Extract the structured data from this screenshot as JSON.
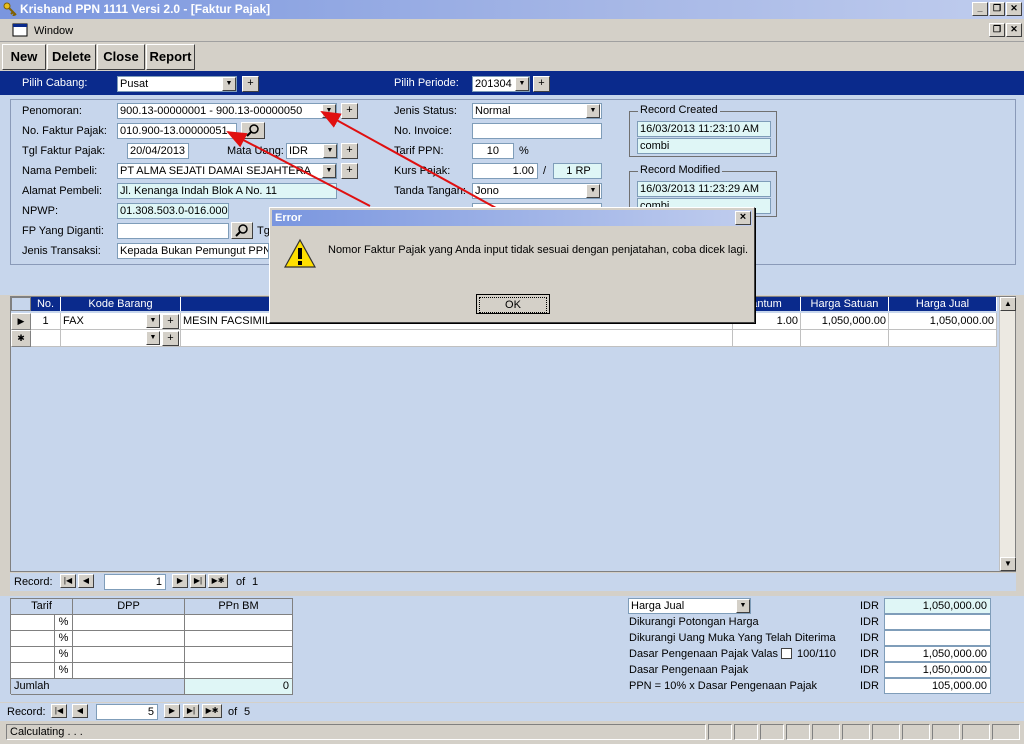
{
  "app": {
    "title": "Krishand PPN 1111 Versi 2.0 - [Faktur Pajak]",
    "menu_window": "Window"
  },
  "toolbar": {
    "new": "New",
    "delete": "Delete",
    "close": "Close",
    "report": "Report"
  },
  "header": {
    "cabang_label": "Pilih Cabang:",
    "cabang_value": "Pusat",
    "periode_label": "Pilih Periode:",
    "periode_value": "201304",
    "plus": "+"
  },
  "form": {
    "penomoran_label": "Penomoran:",
    "penomoran_value": "900.13-00000001 - 900.13-00000050",
    "nofaktur_label": "No. Faktur Pajak:",
    "nofaktur_value": "010.900-13.00000051",
    "tgl_label": "Tgl Faktur Pajak:",
    "tgl_value": "20/04/2013",
    "mata_label": "Mata Uang:",
    "mata_value": "IDR",
    "pembeli_label": "Nama Pembeli:",
    "pembeli_value": "PT ALMA SEJATI DAMAI SEJAHTERA",
    "alamat_label": "Alamat Pembeli:",
    "alamat_value": "Jl. Kenanga Indah Blok A No. 11",
    "npwp_label": "NPWP:",
    "npwp_value": "01.308.503.0-016.000",
    "fp_label": "FP Yang Diganti:",
    "fp_value": "",
    "tg_label": "Tg",
    "transaksi_label": "Jenis Transaksi:",
    "transaksi_value": "Kepada Bukan Pemungut PPN",
    "status_label": "Jenis Status:",
    "status_value": "Normal",
    "invoice_label": "No. Invoice:",
    "invoice_value": "",
    "tarif_label": "Tarif PPN:",
    "tarif_value": "10",
    "tarif_unit": "%",
    "kurs_label": "Kurs Pajak:",
    "kurs_value": "1.00",
    "kurs_sep": "/",
    "kurs_unit": "1 RP",
    "ttd_label": "Tanda Tangan:",
    "ttd_value": "Jono",
    "created_title": "Record Created",
    "created_date": "16/03/2013 11:23:10 AM",
    "created_user": "combi",
    "modified_title": "Record Modified",
    "modified_date": "16/03/2013 11:23:29 AM",
    "modified_user": "combi"
  },
  "grid": {
    "headers": {
      "no": "No.",
      "kode": "Kode Barang",
      "kuantum": "antum",
      "harga_satuan": "Harga Satuan",
      "harga_jual": "Harga Jual"
    },
    "row": {
      "no": "1",
      "kode": "FAX",
      "nama": "MESIN FACSIMILE",
      "kuantum": "1.00",
      "harga_satuan": "1,050,000.00",
      "harga_jual": "1,050,000.00"
    },
    "new_marker": "✱",
    "nav": {
      "label": "Record:",
      "value": "1",
      "of": "of",
      "total": "1"
    }
  },
  "tax": {
    "tarif": "Tarif",
    "dpp": "DPP",
    "ppnbm": "PPn BM",
    "pct": "%",
    "jumlah": "Jumlah",
    "jumlah_value": "0"
  },
  "summary": {
    "basis": "Harga Jual",
    "currency": "IDR",
    "harga_jual_value": "1,050,000.00",
    "potongan": "Dikurangi Potongan Harga",
    "uang_muka": "Dikurangi Uang Muka Yang Telah Diterima",
    "dpp_valas": "Dasar Pengenaan Pajak Valas",
    "ratio": "100/110",
    "dpp_valas_value": "1,050,000.00",
    "dpp": "Dasar Pengenaan Pajak",
    "dpp_value": "1,050,000.00",
    "ppn": "PPN = 10% x  Dasar Pengenaan Pajak",
    "ppn_value": "105,000.00"
  },
  "nav_main": {
    "label": "Record:",
    "value": "5",
    "of": "of",
    "total": "5"
  },
  "status": {
    "text": "Calculating . . ."
  },
  "dialog": {
    "title": "Error",
    "message": "Nomor Faktur Pajak yang Anda input tidak sesuai dengan penjatahan, coba dicek lagi.",
    "ok": "OK",
    "close": "×"
  }
}
